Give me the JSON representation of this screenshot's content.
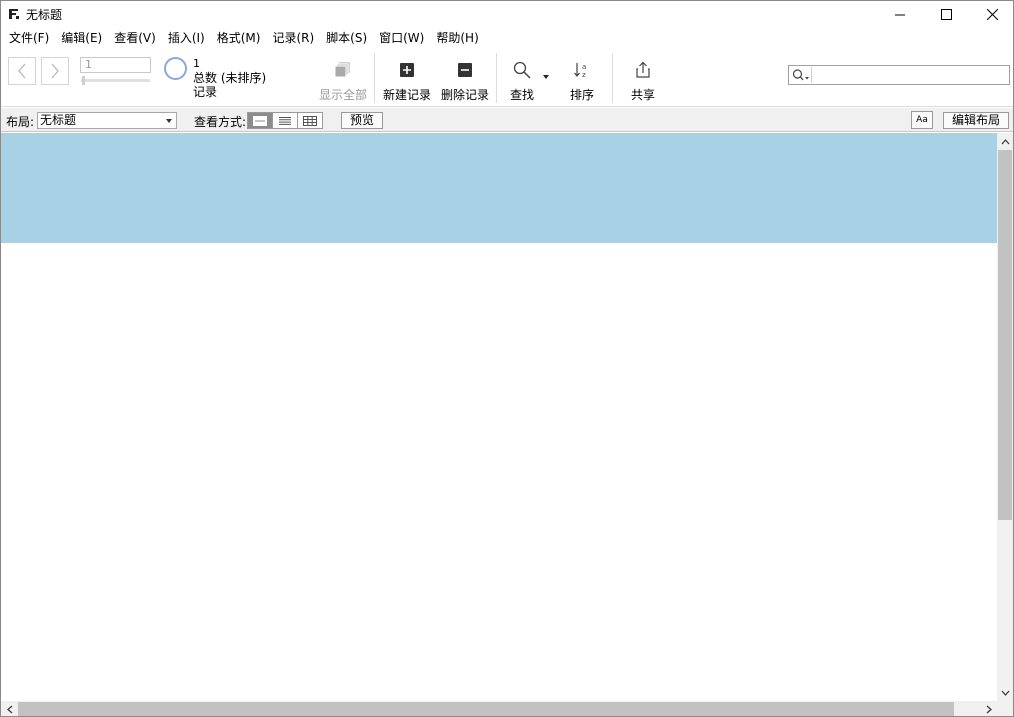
{
  "window": {
    "title": "无标题"
  },
  "menu": [
    "文件(F)",
    "编辑(E)",
    "查看(V)",
    "插入(I)",
    "格式(M)",
    "记录(R)",
    "脚本(S)",
    "窗口(W)",
    "帮助(H)"
  ],
  "toolbar": {
    "record_number": "1",
    "found_count": "1",
    "total_label": "总数 (未排序)",
    "records_label": "记录",
    "show_all": "显示全部",
    "new_record": "新建记录",
    "delete_record": "删除记录",
    "find": "查找",
    "sort": "排序",
    "share": "共享",
    "search_value": ""
  },
  "layout_bar": {
    "layout_label": "布局:",
    "layout_value": "无标题",
    "view_as_label": "查看方式:",
    "preview": "预览",
    "font_button": "Aa",
    "edit_layout": "编辑布局",
    "active_view": "form"
  },
  "colors": {
    "header_part": "#a9d1e6",
    "pie_ring": "#8aa8e0"
  }
}
